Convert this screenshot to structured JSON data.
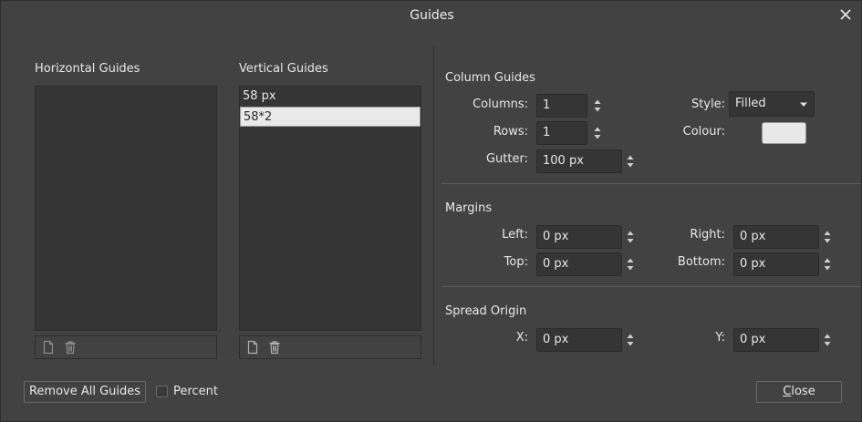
{
  "dialog": {
    "title": "Guides"
  },
  "horizontal": {
    "label": "Horizontal Guides",
    "items": []
  },
  "vertical": {
    "label": "Vertical Guides",
    "items": [
      "58 px",
      "58*2"
    ]
  },
  "column_guides": {
    "title": "Column Guides",
    "columns_label": "Columns:",
    "columns_value": "1",
    "rows_label": "Rows:",
    "rows_value": "1",
    "gutter_label": "Gutter:",
    "gutter_value": "100 px",
    "style_label": "Style:",
    "style_value": "Filled",
    "colour_label": "Colour:",
    "colour_value": "#e8e8e8"
  },
  "margins": {
    "title": "Margins",
    "left_label": "Left:",
    "left_value": "0 px",
    "top_label": "Top:",
    "top_value": "0 px",
    "right_label": "Right:",
    "right_value": "0 px",
    "bottom_label": "Bottom:",
    "bottom_value": "0 px"
  },
  "spread_origin": {
    "title": "Spread Origin",
    "x_label": "X:",
    "x_value": "0 px",
    "y_label": "Y:",
    "y_value": "0 px"
  },
  "footer": {
    "remove_all_label": "Remove All Guides",
    "percent_label": "Percent",
    "close_first": "C",
    "close_rest": "lose"
  },
  "icons": {
    "close": "close-icon",
    "add": "new-document-icon",
    "delete": "trash-icon",
    "spin": "up-down-arrows-icon",
    "caret": "chevron-down-icon"
  }
}
